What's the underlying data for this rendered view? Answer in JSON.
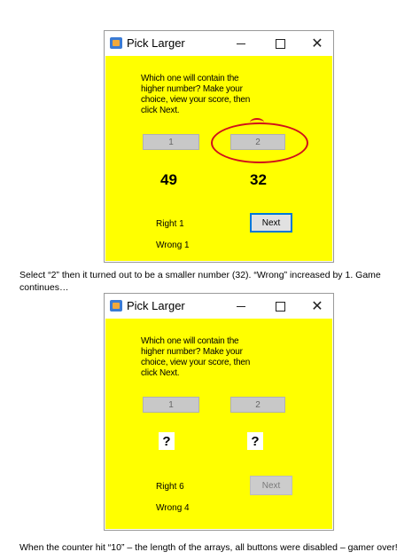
{
  "window1": {
    "title": "Pick Larger",
    "controls": {
      "minimize": "—",
      "maximize": "☐",
      "close": "✕"
    },
    "prompt": "Which one will contain the higher number? Make your choice, view your score, then click Next.",
    "button1_label": "1",
    "button2_label": "2",
    "left_number": "49",
    "right_number": "32",
    "right_label": "Right 1",
    "wrong_label": "Wrong 1",
    "next_label": "Next",
    "accent": "#0078d7",
    "annotation_color": "#d0101a"
  },
  "caption1": "Select “2” then it turned out to be a smaller number (32). “Wrong” increased by 1. Game continues…",
  "window2": {
    "title": "Pick Larger",
    "controls": {
      "minimize": "—",
      "maximize": "☐",
      "close": "✕"
    },
    "prompt": "Which one will contain the higher number? Make your choice, view your score, then click Next.",
    "button1_label": "1",
    "button2_label": "2",
    "left_number": "?",
    "right_number": "?",
    "right_label": "Right 6",
    "wrong_label": "Wrong 4",
    "next_label": "Next"
  },
  "caption2": "When the counter hit “10” – the length of the arrays, all buttons were disabled – gamer over!",
  "colors": {
    "client_background": "#ffff00",
    "button_gray": "#c8c8c8"
  }
}
